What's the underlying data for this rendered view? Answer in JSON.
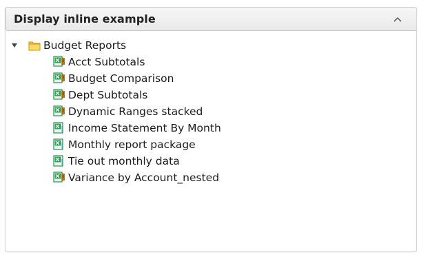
{
  "panel": {
    "title": "Display inline example",
    "collapse_icon": "chevron-up-icon"
  },
  "tree": {
    "folder": {
      "label": "Budget Reports",
      "icon": "folder-icon",
      "expanded": true
    },
    "items": [
      {
        "label": "Acct Subtotals",
        "icon": "excel-warning-icon"
      },
      {
        "label": "Budget Comparison",
        "icon": "excel-warning-icon"
      },
      {
        "label": "Dept Subtotals",
        "icon": "excel-warning-icon"
      },
      {
        "label": "Dynamic Ranges stacked",
        "icon": "excel-warning-icon"
      },
      {
        "label": "Income Statement By Month",
        "icon": "excel-file-icon"
      },
      {
        "label": "Monthly report package",
        "icon": "excel-file-icon"
      },
      {
        "label": "Tie out monthly data",
        "icon": "excel-file-icon"
      },
      {
        "label": "Variance by Account_nested",
        "icon": "excel-warning-icon"
      }
    ]
  },
  "colors": {
    "excel_green": "#1f8a3a",
    "folder_yellow": "#f2c94c",
    "warning_orange": "#f39c12"
  }
}
